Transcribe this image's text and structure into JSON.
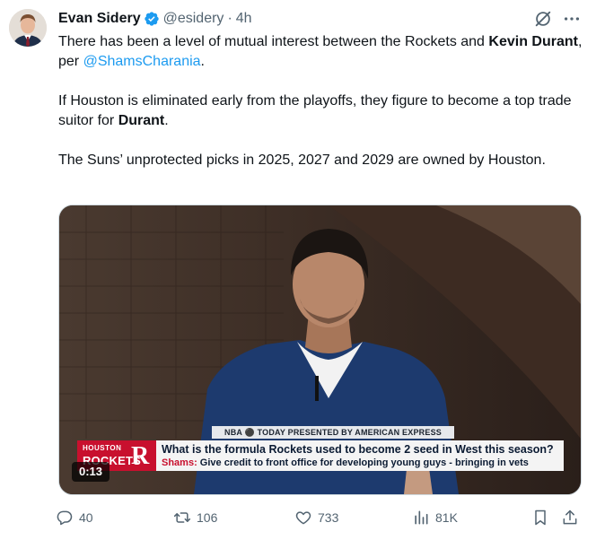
{
  "author": {
    "display_name": "Evan Sidery",
    "handle": "@esidery",
    "separator": "·",
    "timestamp": "4h",
    "verified": true,
    "verified_color": "#1d9bf0"
  },
  "tweet": {
    "p1_a": "There has been a level of mutual interest between the Rockets and ",
    "p1_b": "Kevin Durant",
    "p1_c": ", per ",
    "p1_mention": "@ShamsCharania",
    "p1_d": ".",
    "p2_a": "If Houston is eliminated early from the playoffs, they figure to become a top trade suitor for ",
    "p2_b": "Durant",
    "p2_c": ".",
    "p3": "The Suns’ unprotected picks in 2025, 2027 and 2029 are owned by Houston."
  },
  "media": {
    "ticker_top": "NBA ⚫ TODAY PRESENTED BY AMERICAN EXPRESS",
    "logo_city": "HOUSTON",
    "logo_team": "ROCKETS",
    "logo_mark": "R",
    "headline": "What is the formula Rockets used to become 2 seed in West this season?",
    "subline_who": "Shams:",
    "subline_text": " Give credit to front office for developing young guys - bringing in vets",
    "duration": "0:13"
  },
  "actions": {
    "replies": "40",
    "retweets": "106",
    "likes": "733",
    "views": "81K"
  },
  "colors": {
    "accent": "#1d9bf0",
    "muted": "#536471",
    "rockets_red": "#c8102e"
  },
  "icons": {
    "header": [
      "verified-badge-icon",
      "grok-icon",
      "more-icon"
    ],
    "actions": [
      "reply-icon",
      "retweet-icon",
      "like-icon",
      "views-icon",
      "bookmark-icon",
      "share-icon"
    ]
  }
}
